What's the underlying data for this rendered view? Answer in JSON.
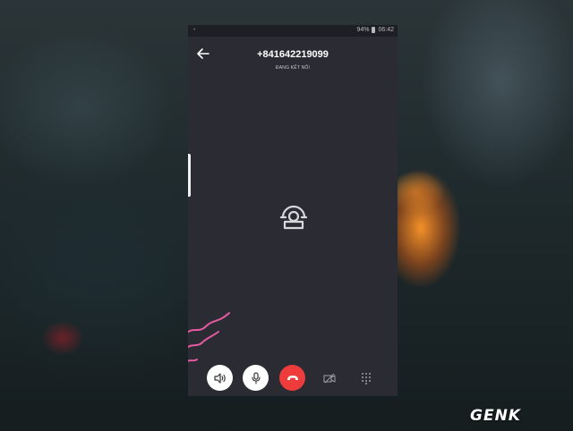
{
  "status_bar": {
    "battery": "94%",
    "time": "06:42"
  },
  "call": {
    "phone_number": "+841642219099",
    "state": "ĐANG KẾT NỐI"
  },
  "controls": {
    "speaker": "speaker-icon",
    "microphone": "microphone-icon",
    "end_call": "end-call-icon",
    "video": "video-off-icon",
    "dialpad": "dialpad-icon"
  },
  "colors": {
    "screen_background": "#2b2c33",
    "end_call": "#ee3b3b",
    "accent_squiggle": "#e35aa0"
  },
  "watermark": {
    "text": "GENK"
  }
}
